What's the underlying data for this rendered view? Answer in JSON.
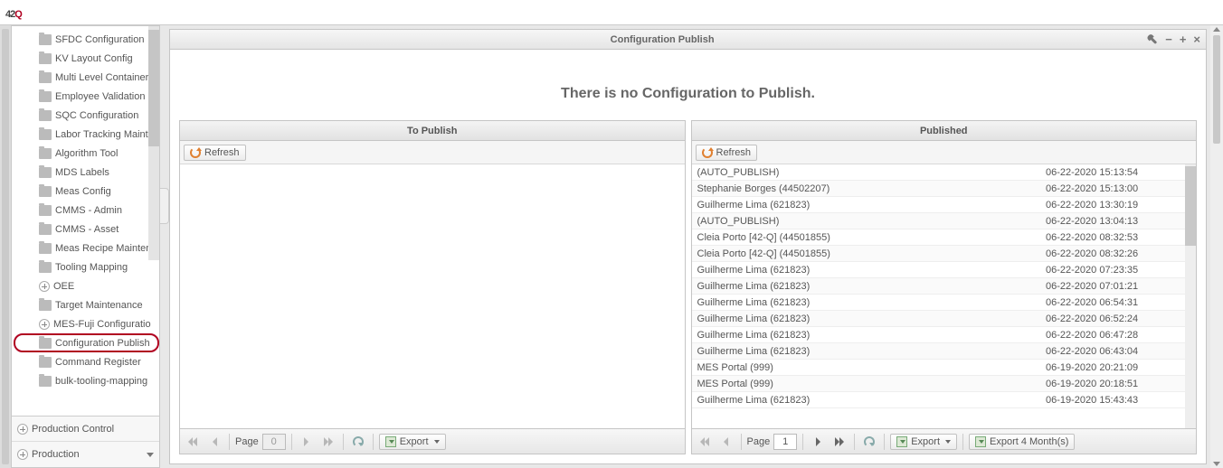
{
  "logo": {
    "p1": "4",
    "p2": "2",
    "p3": "Q"
  },
  "sidebar": {
    "items": [
      {
        "label": "SFDC Configuration"
      },
      {
        "label": "KV Layout Config"
      },
      {
        "label": "Multi Level Container"
      },
      {
        "label": "Employee Validation C"
      },
      {
        "label": "SQC Configuration"
      },
      {
        "label": "Labor Tracking Mainte"
      },
      {
        "label": "Algorithm Tool"
      },
      {
        "label": "MDS Labels"
      },
      {
        "label": "Meas Config"
      },
      {
        "label": "CMMS - Admin"
      },
      {
        "label": "CMMS - Asset"
      },
      {
        "label": "Meas Recipe Maintena"
      },
      {
        "label": "Tooling Mapping"
      },
      {
        "label": "OEE",
        "icon": "plus"
      },
      {
        "label": "Target Maintenance"
      },
      {
        "label": "MES-Fuji Configuratio",
        "icon": "plus"
      },
      {
        "label": "Configuration Publish",
        "selected": true
      },
      {
        "label": "Command Register"
      },
      {
        "label": "bulk-tooling-mapping"
      }
    ],
    "footer1": {
      "label": "Production Control",
      "icon": "plus"
    },
    "footer2": {
      "label": "Production"
    }
  },
  "panel": {
    "title": "Configuration Publish",
    "message": "There is no Configuration to Publish."
  },
  "leftGrid": {
    "header": "To Publish",
    "refresh": "Refresh",
    "page_label": "Page",
    "page_value": "0",
    "export": "Export"
  },
  "rightGrid": {
    "header": "Published",
    "refresh": "Refresh",
    "page_label": "Page",
    "page_value": "1",
    "export": "Export",
    "export4": "Export 4 Month(s)",
    "rows": [
      {
        "user": "(AUTO_PUBLISH)",
        "ts": "06-22-2020 15:13:54"
      },
      {
        "user": "Stephanie Borges (44502207)",
        "ts": "06-22-2020 15:13:00"
      },
      {
        "user": "Guilherme Lima (621823)",
        "ts": "06-22-2020 13:30:19"
      },
      {
        "user": "(AUTO_PUBLISH)",
        "ts": "06-22-2020 13:04:13"
      },
      {
        "user": "Cleia Porto [42-Q] (44501855)",
        "ts": "06-22-2020 08:32:53"
      },
      {
        "user": "Cleia Porto [42-Q] (44501855)",
        "ts": "06-22-2020 08:32:26"
      },
      {
        "user": "Guilherme Lima (621823)",
        "ts": "06-22-2020 07:23:35"
      },
      {
        "user": "Guilherme Lima (621823)",
        "ts": "06-22-2020 07:01:21"
      },
      {
        "user": "Guilherme Lima (621823)",
        "ts": "06-22-2020 06:54:31"
      },
      {
        "user": "Guilherme Lima (621823)",
        "ts": "06-22-2020 06:52:24"
      },
      {
        "user": "Guilherme Lima (621823)",
        "ts": "06-22-2020 06:47:28"
      },
      {
        "user": "Guilherme Lima (621823)",
        "ts": "06-22-2020 06:43:04"
      },
      {
        "user": "MES Portal (999)",
        "ts": "06-19-2020 20:21:09"
      },
      {
        "user": "MES Portal (999)",
        "ts": "06-19-2020 20:18:51"
      },
      {
        "user": "Guilherme Lima (621823)",
        "ts": "06-19-2020 15:43:43"
      }
    ]
  }
}
